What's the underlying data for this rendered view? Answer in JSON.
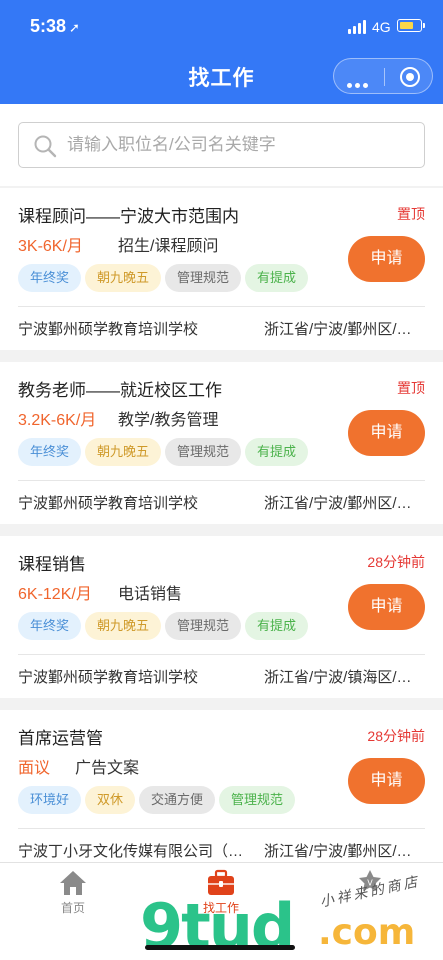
{
  "status_bar": {
    "time": "5:38",
    "location_glyph": "➚",
    "network": "4G",
    "battery_color": "#f8d649"
  },
  "nav": {
    "title": "找工作",
    "more_icon": "more-dots-icon",
    "close_icon": "target-circle-icon"
  },
  "search": {
    "value": "",
    "placeholder": "请输入职位名/公司名关键字"
  },
  "jobs": [
    {
      "title": "课程顾问——宁波大市范围内",
      "meta": "置顶",
      "salary": "3K-6K/月",
      "category": "招生/课程顾问",
      "tags": [
        "年终奖",
        "朝九晚五",
        "管理规范",
        "有提成"
      ],
      "apply": "申请",
      "company": "宁波鄞州硕学教育培训学校",
      "location": "浙江省/宁波/鄞州区/…"
    },
    {
      "title": "教务老师——就近校区工作",
      "meta": "置顶",
      "salary": "3.2K-6K/月",
      "category": "教学/教务管理",
      "tags": [
        "年终奖",
        "朝九晚五",
        "管理规范",
        "有提成"
      ],
      "apply": "申请",
      "company": "宁波鄞州硕学教育培训学校",
      "location": "浙江省/宁波/鄞州区/…"
    },
    {
      "title": "课程销售",
      "meta": "28分钟前",
      "salary": "6K-12K/月",
      "category": "电话销售",
      "tags": [
        "年终奖",
        "朝九晚五",
        "管理规范",
        "有提成"
      ],
      "apply": "申请",
      "company": "宁波鄞州硕学教育培训学校",
      "location": "浙江省/宁波/镇海区/…"
    },
    {
      "title": "首席运营管",
      "meta": "28分钟前",
      "salary": "面议",
      "category": "广告文案",
      "tags": [
        "环境好",
        "双休",
        "交通方便",
        "管理规范"
      ],
      "apply": "申请",
      "company": "宁波丁小牙文化传媒有限公司（…",
      "location": "浙江省/宁波/鄞州区/…"
    }
  ],
  "tabbar": {
    "tabs": [
      {
        "label": "首页",
        "icon": "home-icon"
      },
      {
        "label": "找工作",
        "icon": "briefcase-icon"
      },
      {
        "label": "",
        "icon": "star-badge-icon"
      }
    ],
    "active_color": "#e0421a"
  },
  "watermark": {
    "logo": "9tud",
    "suffix": ".com",
    "shop": "小祥来的商店"
  },
  "colors": {
    "header": "#3478f6",
    "accent": "#f0722e",
    "salary": "#f0652d",
    "meta": "#e53935"
  }
}
